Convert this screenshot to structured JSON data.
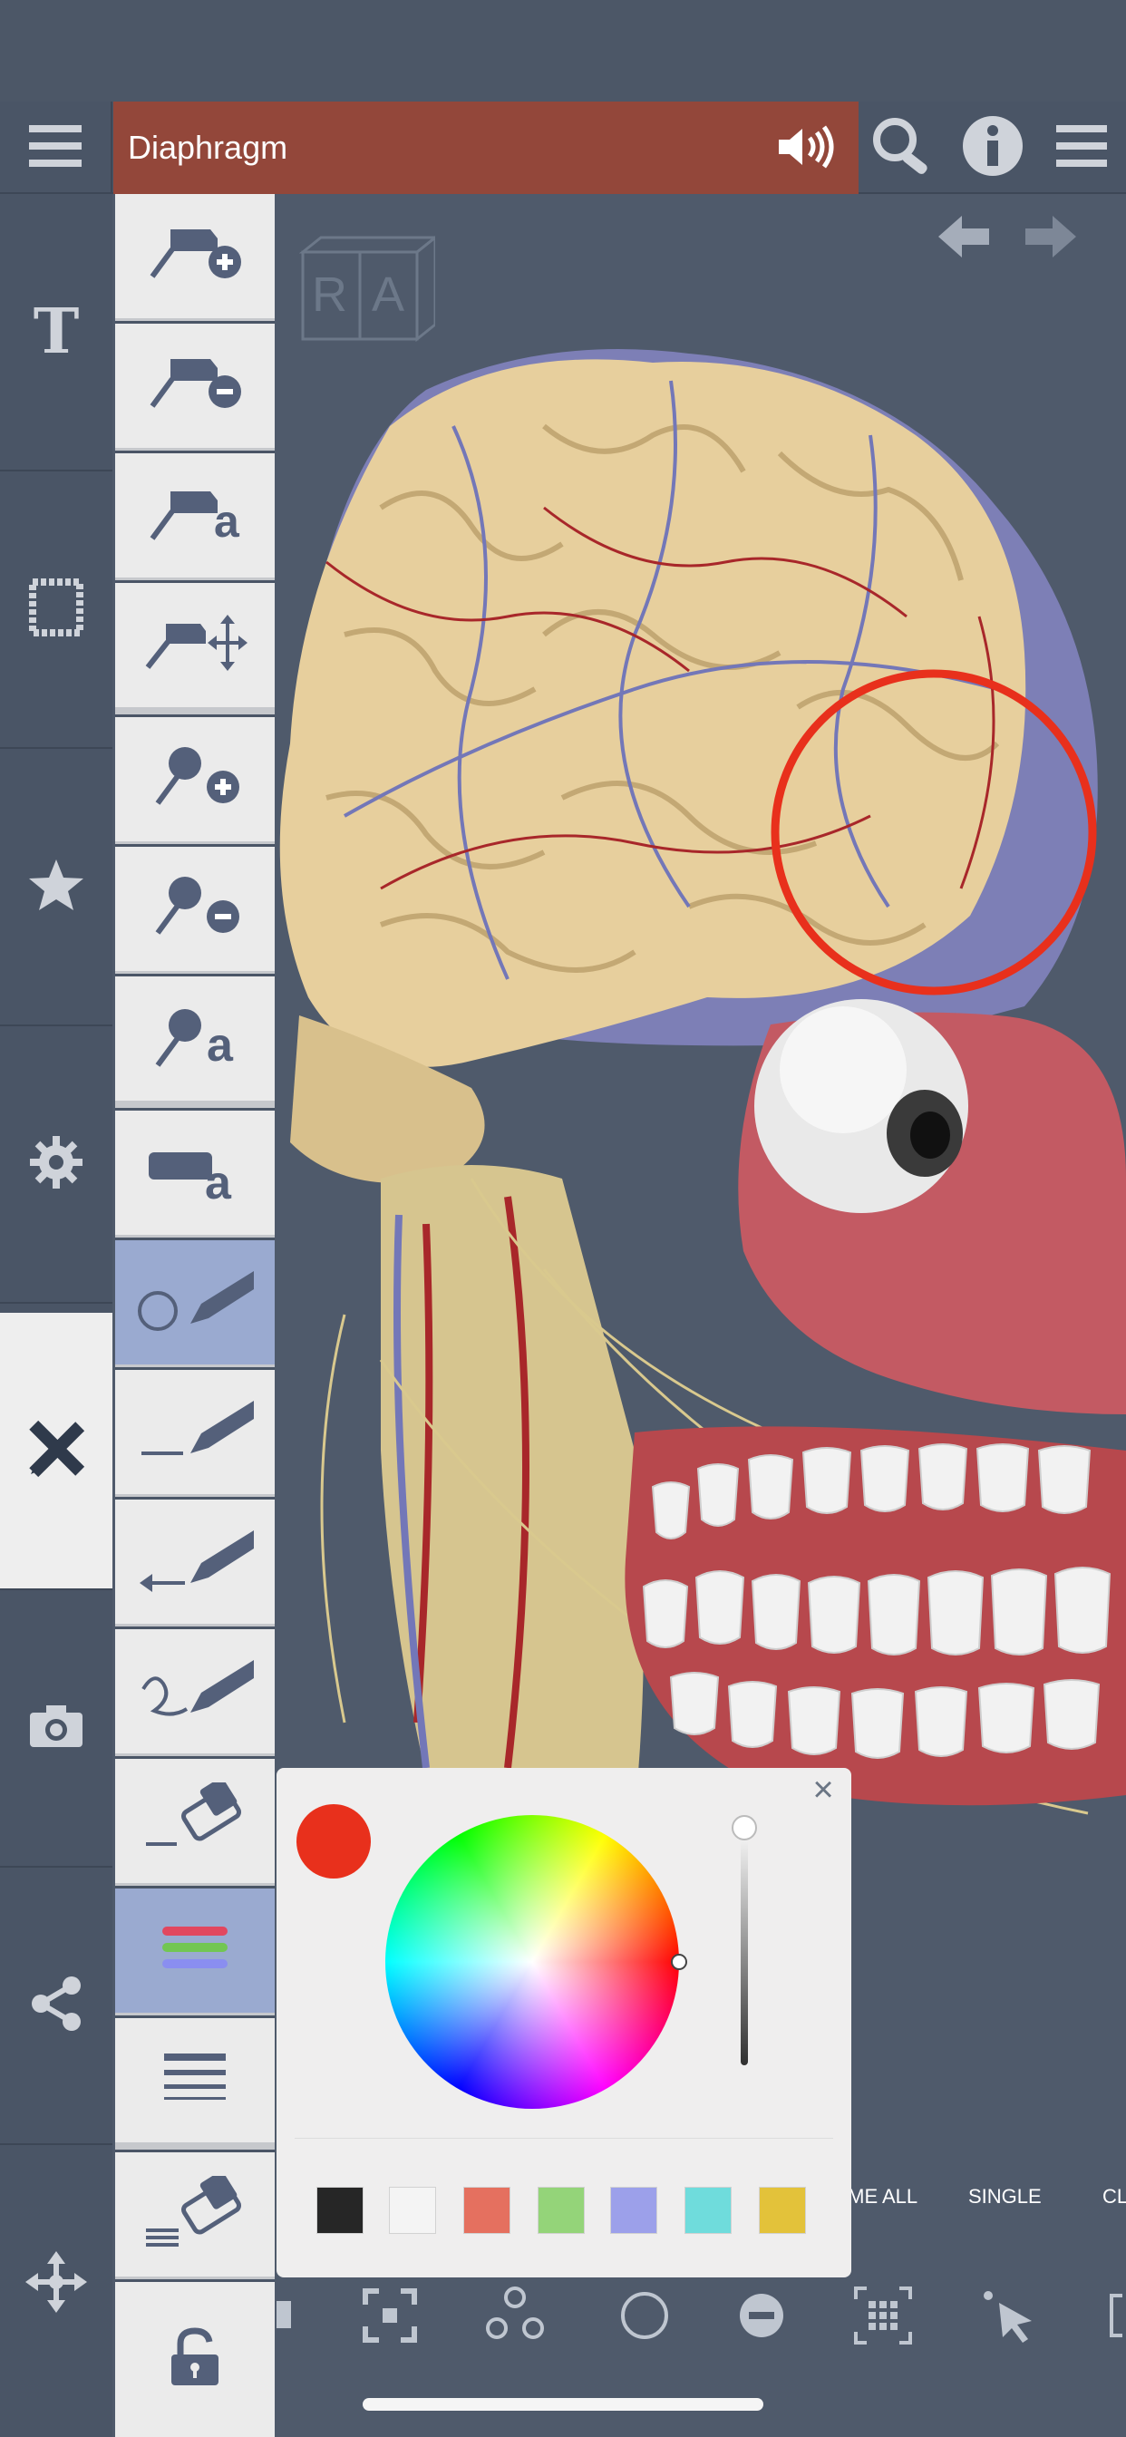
{
  "header": {
    "title": "Diaphragm",
    "menu_icon": "hamburger-icon",
    "speaker_icon": "speaker-icon",
    "search_icon": "search-icon",
    "info_icon": "info-icon",
    "right_menu_icon": "list-menu-icon"
  },
  "sidebar": {
    "items": [
      {
        "icon": "text-icon",
        "label": "T"
      },
      {
        "icon": "frame-icon"
      },
      {
        "icon": "star-icon"
      },
      {
        "icon": "gear-icon"
      },
      {
        "icon": "pencil-ruler-icon",
        "active": true
      },
      {
        "icon": "camera-icon"
      },
      {
        "icon": "share-icon"
      },
      {
        "icon": "move-arrows-icon"
      }
    ]
  },
  "tools": [
    {
      "icon": "add-pin-flag-icon"
    },
    {
      "icon": "remove-pin-flag-icon"
    },
    {
      "icon": "label-pin-flag-icon",
      "text": "a"
    },
    {
      "icon": "move-pin-flag-icon"
    },
    {
      "icon": "add-pin-icon"
    },
    {
      "icon": "remove-pin-icon"
    },
    {
      "icon": "label-pin-icon",
      "text": "a"
    },
    {
      "icon": "label-box-icon",
      "text": "a"
    },
    {
      "icon": "circle-pen-icon",
      "selected": true
    },
    {
      "icon": "line-pen-icon"
    },
    {
      "icon": "arrow-pen-icon"
    },
    {
      "icon": "freehand-pen-icon"
    },
    {
      "icon": "eraser-icon"
    },
    {
      "icon": "color-lines-icon",
      "selected": true
    },
    {
      "icon": "line-width-icon"
    },
    {
      "icon": "erase-all-icon"
    },
    {
      "icon": "unlock-icon"
    }
  ],
  "viewport": {
    "orientation_cube": {
      "left": "R",
      "right": "A"
    },
    "back_icon": "arrow-left-icon",
    "forward_icon": "arrow-right-icon"
  },
  "color_picker": {
    "current_color": "#e8301c",
    "close_label": "×",
    "swatches": [
      "#262626",
      "#f4f4f4",
      "#e5705f",
      "#94d479",
      "#9ca0ea",
      "#6fdcdc",
      "#e3c23a"
    ]
  },
  "bottom_bar": {
    "labels": [
      "OME ALL",
      "SINGLE",
      "CL"
    ],
    "icons": [
      "partial-icon",
      "collapse-icon",
      "nodes-icon",
      "circle-icon",
      "minus-circle-icon",
      "grid-select-icon",
      "pointer-icon",
      "bracket-icon"
    ]
  }
}
